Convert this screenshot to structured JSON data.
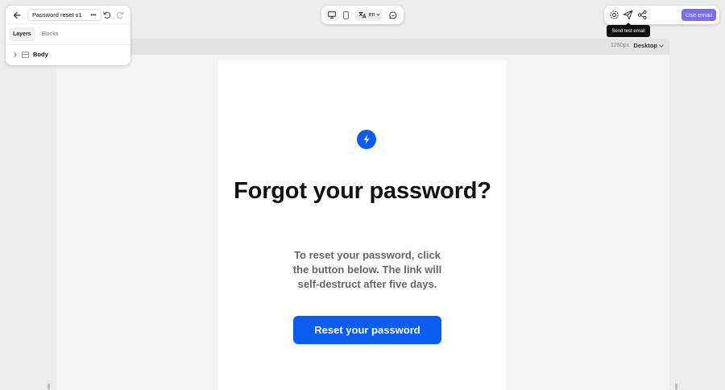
{
  "editor": {
    "template_name": "Password reset v1",
    "tabs": [
      {
        "label": "Layers",
        "active": true
      },
      {
        "label": "Blocks",
        "active": false
      }
    ],
    "layers": [
      {
        "label": "Body"
      }
    ]
  },
  "toolbar": {
    "language": "en",
    "use_email_label": "Use email",
    "tooltip": "Send test email"
  },
  "canvas": {
    "width_label": "1280px",
    "device": "Desktop"
  },
  "email": {
    "headline": "Forgot your password?",
    "body": "To reset your password, click the button below. The link will self-destruct after five days.",
    "cta_label": "Reset your password"
  },
  "colors": {
    "brand_blue": "#0b5cf0",
    "accent_purple": "#7b6cf6"
  },
  "icons": [
    "arrow-left-icon",
    "more-horizontal-icon",
    "undo-icon",
    "redo-icon",
    "chevron-right-icon",
    "frame-icon",
    "monitor-icon",
    "smartphone-icon",
    "translate-icon",
    "chevron-down-icon",
    "message-circle-icon",
    "gear-icon",
    "send-icon",
    "share-icon",
    "bolt-logo-icon"
  ]
}
